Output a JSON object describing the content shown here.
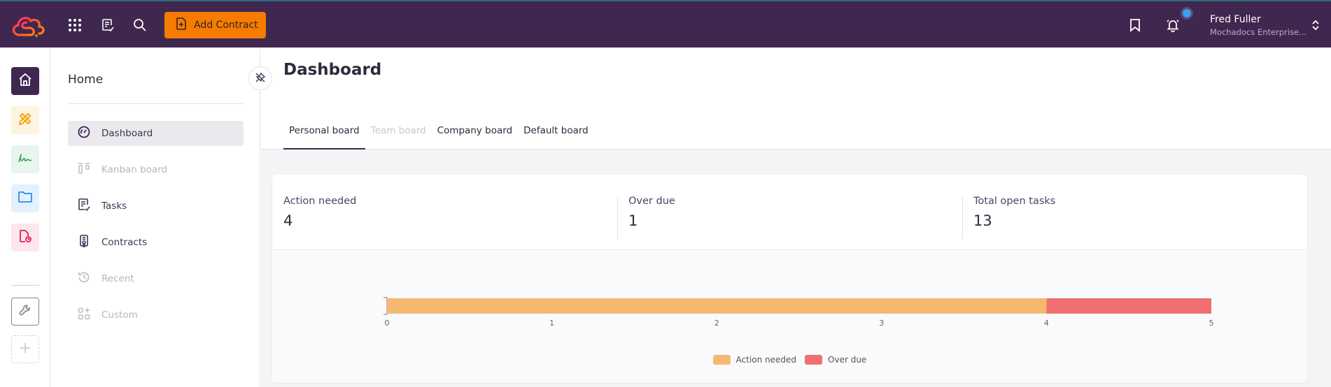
{
  "topbar": {
    "logo": "mochadocs-cloud-logo",
    "icons": [
      "apps-grid-icon",
      "tasks-icon",
      "search-icon"
    ],
    "add_contract_label": "Add Contract",
    "bookmark_icon": "bookmark-icon",
    "notification_icon": "bell-icon",
    "user_name": "Fred Fuller",
    "user_org": "Mochadocs Enterprise...",
    "accent": "#f57c00",
    "bar_color": "#402750"
  },
  "rail": {
    "items": [
      {
        "name": "home",
        "icon": "home-icon",
        "bg": "#402750",
        "fg": "#ffffff"
      },
      {
        "name": "design",
        "icon": "pencil-ruler-icon",
        "bg": "#fdf3e0",
        "fg": "#f0a500"
      },
      {
        "name": "signature",
        "icon": "signature-icon",
        "bg": "#e8f5ec",
        "fg": "#3aa05a"
      },
      {
        "name": "folder",
        "icon": "folder-icon",
        "bg": "#e3f1fd",
        "fg": "#2a8ae8"
      },
      {
        "name": "report",
        "icon": "file-chart-icon",
        "bg": "#fde6ec",
        "fg": "#e0205a"
      }
    ],
    "settings_icon": "wrench-icon",
    "add_icon": "plus-icon"
  },
  "sidebar": {
    "title": "Home",
    "items": [
      {
        "label": "Dashboard",
        "icon": "gauge-icon",
        "state": "active"
      },
      {
        "label": "Kanban board",
        "icon": "kanban-icon",
        "state": "disabled"
      },
      {
        "label": "Tasks",
        "icon": "tasks-icon",
        "state": "enabled"
      },
      {
        "label": "Contracts",
        "icon": "contract-icon",
        "state": "enabled"
      },
      {
        "label": "Recent",
        "icon": "history-icon",
        "state": "disabled"
      },
      {
        "label": "Custom",
        "icon": "grid-plus-icon",
        "state": "disabled"
      }
    ]
  },
  "main": {
    "title": "Dashboard",
    "tabs": [
      {
        "label": "Personal board",
        "state": "active"
      },
      {
        "label": "Team board",
        "state": "disabled"
      },
      {
        "label": "Company board",
        "state": "normal"
      },
      {
        "label": "Default board",
        "state": "normal"
      }
    ],
    "stats": [
      {
        "label": "Action needed",
        "value": "4"
      },
      {
        "label": "Over due",
        "value": "1"
      },
      {
        "label": "Total open tasks",
        "value": "13"
      }
    ]
  },
  "chart_data": {
    "type": "bar",
    "orientation": "horizontal",
    "stacked": true,
    "categories": [
      ""
    ],
    "series": [
      {
        "name": "Action needed",
        "values": [
          4
        ],
        "color": "#f6b870"
      },
      {
        "name": "Over due",
        "values": [
          1
        ],
        "color": "#f07070"
      }
    ],
    "xlim": [
      0,
      5
    ],
    "xticks": [
      "0",
      "1",
      "2",
      "3",
      "4",
      "5"
    ],
    "title": "",
    "xlabel": "",
    "ylabel": "",
    "grid": false,
    "legend": "bottom-center"
  }
}
